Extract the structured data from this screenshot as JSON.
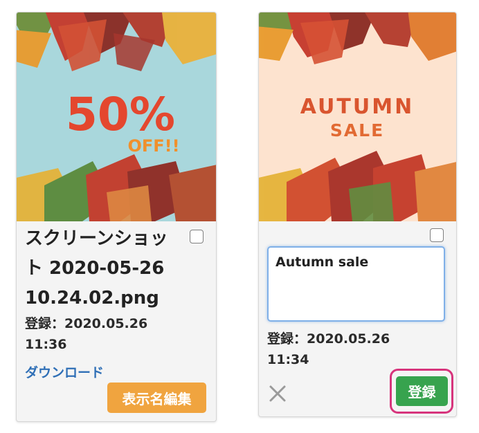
{
  "cards": [
    {
      "image": {
        "headline": "50%",
        "subline": "OFF!!",
        "background_color": "#a9d7dc",
        "text_color": "#e4472e",
        "subline_color": "#f0902c"
      },
      "filename": "スクリーンショット 2020-05-26 10.24.02.png",
      "registered_line1": "登録：2020.05.26",
      "registered_line2": "11:36",
      "download_label": "ダウンロード",
      "rename_button_label": "表示名編集"
    },
    {
      "image": {
        "headline": "AUTUMN",
        "subline": "SALE",
        "background_color": "#fde3cf",
        "text_color": "#d9552f",
        "subline_color": "#e26a33"
      },
      "name_input_value": "Autumn sale",
      "registered_line1": "登録：2020.05.26",
      "registered_line2": "11:34",
      "cancel_icon": "close-icon",
      "register_button_label": "登録"
    }
  ],
  "colors": {
    "rename_button": "#f0a43f",
    "register_button": "#37a34e",
    "highlight_ring": "#d7347c",
    "link": "#2f6fb6",
    "input_focus_border": "#7fb0e8"
  }
}
